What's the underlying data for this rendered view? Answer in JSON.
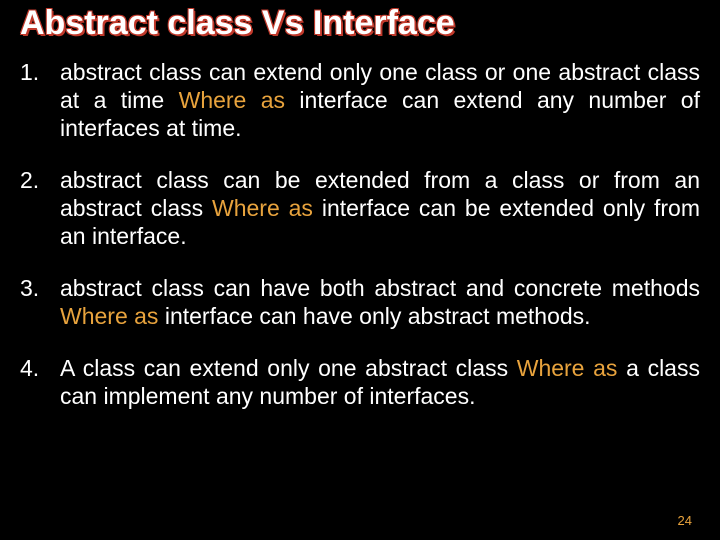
{
  "title": "Abstract class Vs Interface",
  "whereas": "Where as",
  "items": [
    {
      "num": "1.",
      "before": "abstract class can extend only one class or one abstract class at a time ",
      "after": " interface can extend any number of interfaces at time."
    },
    {
      "num": "2.",
      "before": "abstract  class  can be extended from a class or from an abstract class ",
      "after": " interface can be extended only from an interface."
    },
    {
      "num": "3.",
      "before": "abstract  class  can  have  both  abstract and concrete methods ",
      "after": " interface can  have only abstract methods."
    },
    {
      "num": "4.",
      "before": "A class can extend only one abstract class ",
      "after": " a class can implement any number of interfaces."
    }
  ],
  "page": "24"
}
